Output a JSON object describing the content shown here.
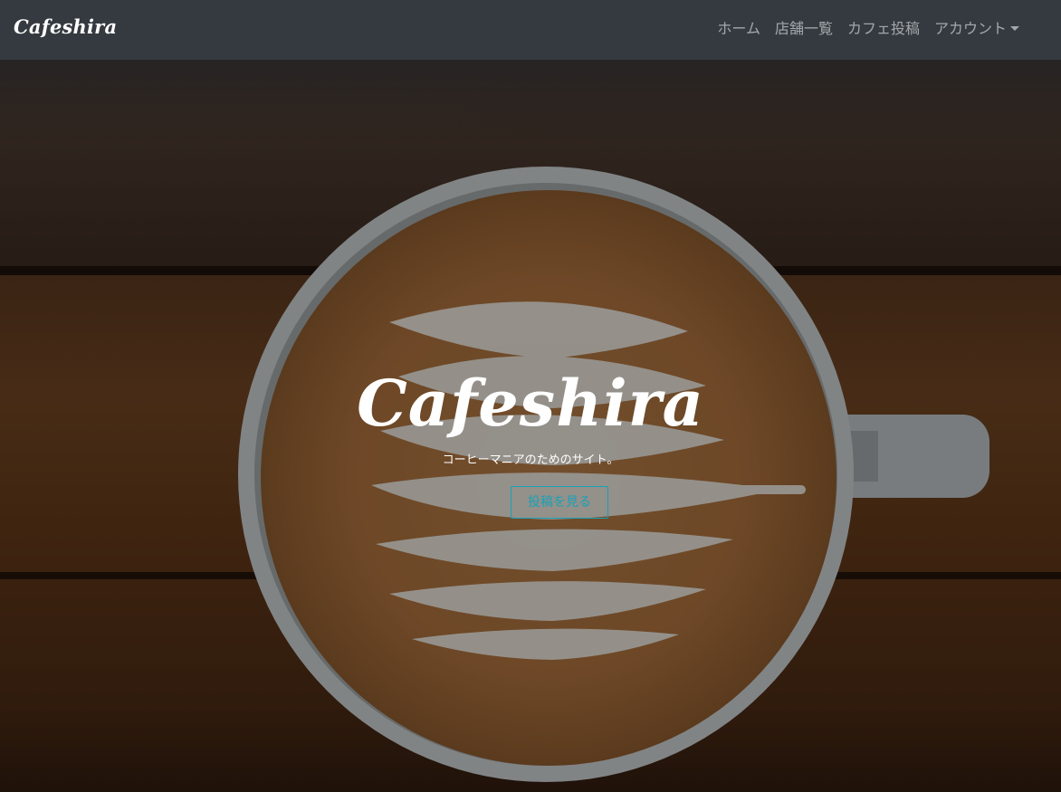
{
  "navbar": {
    "brand": "Cafeshira",
    "links": [
      {
        "label": "ホーム"
      },
      {
        "label": "店舗一覧"
      },
      {
        "label": "カフェ投稿"
      },
      {
        "label": "アカウント"
      }
    ]
  },
  "hero": {
    "title": "Cafeshira",
    "subtitle": "コーヒーマニアのためのサイト。",
    "button_label": "投稿を見る"
  },
  "colors": {
    "navbar_bg": "#343a40",
    "accent": "#17a2b8",
    "hero_text": "#ffffff"
  }
}
